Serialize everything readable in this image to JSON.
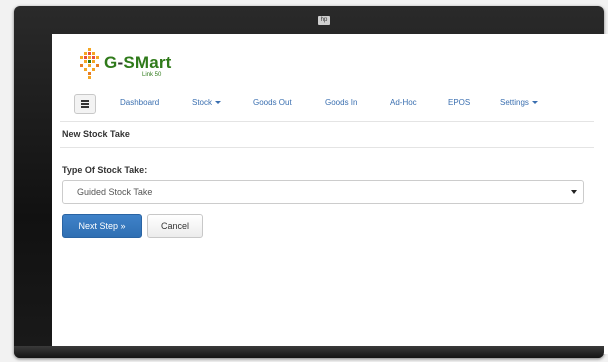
{
  "brand": {
    "name_prefix": "G",
    "name_dash": "-",
    "name_rest": "SMart",
    "subtitle": "Link 50"
  },
  "nav": {
    "menu_icon": "hamburger-icon",
    "items": [
      {
        "label": "Dashboard",
        "dropdown": false
      },
      {
        "label": "Stock",
        "dropdown": true
      },
      {
        "label": "Goods Out",
        "dropdown": false
      },
      {
        "label": "Goods In",
        "dropdown": false
      },
      {
        "label": "Ad-Hoc",
        "dropdown": false
      },
      {
        "label": "EPOS",
        "dropdown": false
      },
      {
        "label": "Settings",
        "dropdown": true
      }
    ]
  },
  "page": {
    "title": "New Stock Take"
  },
  "form": {
    "type_label": "Type Of Stock Take:",
    "type_value": "Guided Stock Take"
  },
  "buttons": {
    "next": "Next Step »",
    "cancel": "Cancel"
  },
  "colors": {
    "brand_green": "#2f7a1a",
    "link_blue": "#3a6fb0",
    "primary_button": "#2f6fb3"
  }
}
